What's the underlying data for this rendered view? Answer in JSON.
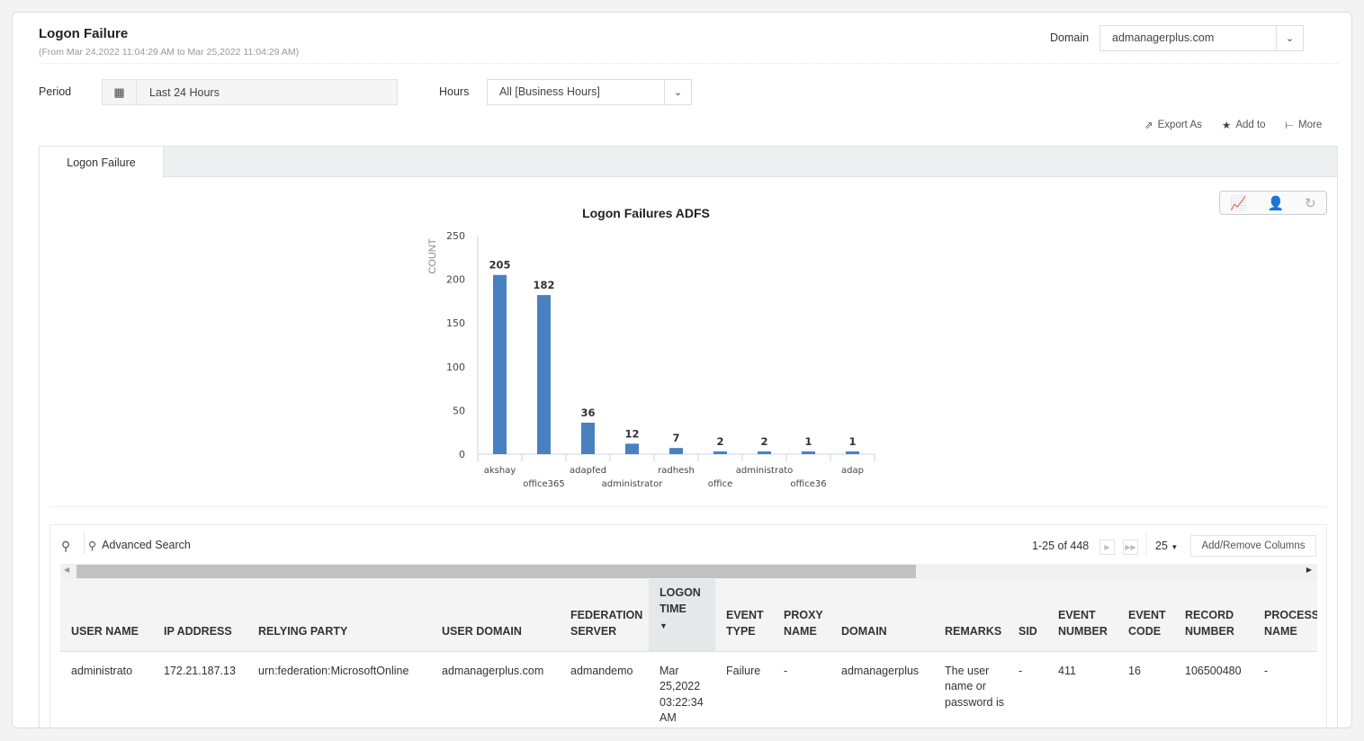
{
  "header": {
    "title": "Logon Failure",
    "subtitle": "(From Mar 24,2022 11:04:29 AM to Mar 25,2022 11:04:29 AM)",
    "domain_label": "Domain",
    "domain_value": "admanagerplus.com"
  },
  "filters": {
    "period_label": "Period",
    "period_value": "Last 24 Hours",
    "hours_label": "Hours",
    "hours_value": "All [Business Hours]"
  },
  "toolbar": {
    "export": "Export As",
    "add_to": "Add to",
    "more": "More"
  },
  "tabs": [
    {
      "label": "Logon Failure",
      "active": true
    }
  ],
  "chart_data": {
    "type": "bar",
    "title": "Logon Failures ADFS",
    "ylabel": "COUNT",
    "xlabel": "",
    "ylim": [
      0,
      250
    ],
    "yticks": [
      0,
      50,
      100,
      150,
      200,
      250
    ],
    "categories": [
      "akshay",
      "office365",
      "adapfed",
      "administrator",
      "radhesh",
      "office",
      "administrato",
      "office36",
      "adap"
    ],
    "values": [
      205,
      182,
      36,
      12,
      7,
      2,
      2,
      1,
      1
    ],
    "color": "#4a80c0",
    "grid": false
  },
  "grid": {
    "advanced_search": "Advanced Search",
    "pagination": "1-25 of 448",
    "page_size": "25",
    "add_remove": "Add/Remove Columns",
    "columns": [
      "USER NAME",
      "IP ADDRESS",
      "RELYING PARTY",
      "USER DOMAIN",
      "FEDERATION SERVER",
      "LOGON TIME",
      "EVENT TYPE",
      "PROXY NAME",
      "DOMAIN",
      "REMARKS",
      "SID",
      "EVENT NUMBER",
      "EVENT CODE",
      "RECORD NUMBER",
      "PROCESS NAME"
    ],
    "sorted_column": "LOGON TIME",
    "rows": [
      [
        "administrato",
        "172.21.187.13",
        "urn:federation:MicrosoftOnline",
        "admanagerplus.com",
        "admandemo",
        "Mar 25,2022 03:22:34 AM",
        "Failure",
        "-",
        "admanagerplus",
        "The user name or password is",
        "-",
        "411",
        "16",
        "106500480",
        "-"
      ]
    ]
  }
}
